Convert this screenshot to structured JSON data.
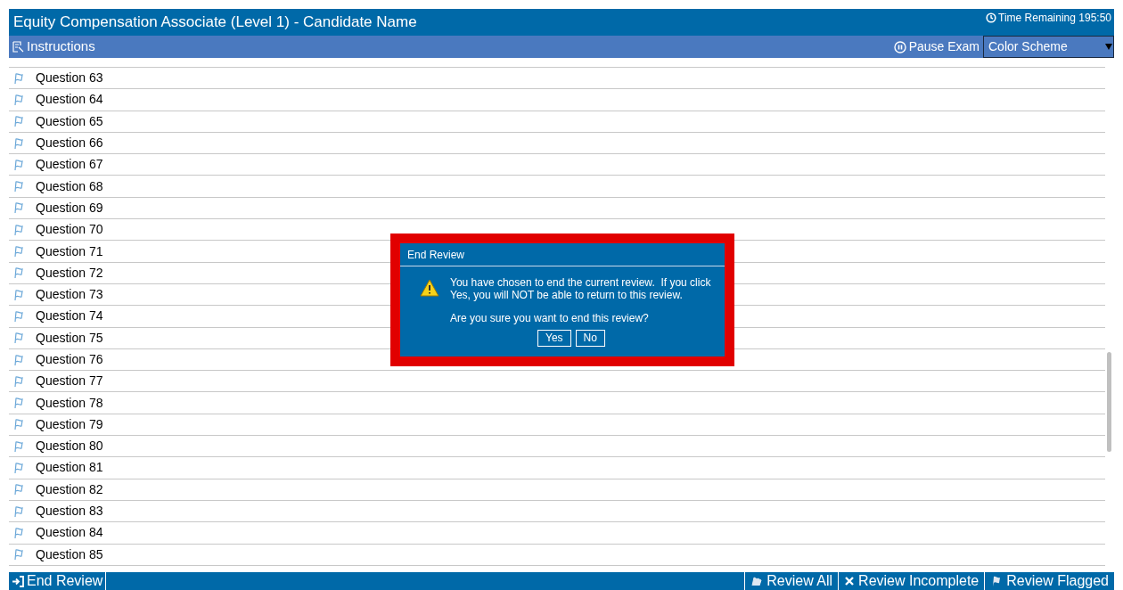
{
  "window": {
    "title": "Equity Compensation Associate (Level 1) - Candidate Name",
    "timer": "Time Remaining 195:50"
  },
  "toolbar": {
    "instructions": "Instructions",
    "pause": "Pause Exam",
    "color_scheme": "Color Scheme"
  },
  "questions": [
    {
      "label": "Question 63"
    },
    {
      "label": "Question 64"
    },
    {
      "label": "Question 65"
    },
    {
      "label": "Question 66"
    },
    {
      "label": "Question 67"
    },
    {
      "label": "Question 68"
    },
    {
      "label": "Question 69"
    },
    {
      "label": "Question 70"
    },
    {
      "label": "Question 71"
    },
    {
      "label": "Question 72"
    },
    {
      "label": "Question 73"
    },
    {
      "label": "Question 74"
    },
    {
      "label": "Question 75"
    },
    {
      "label": "Question 76"
    },
    {
      "label": "Question 77"
    },
    {
      "label": "Question 78"
    },
    {
      "label": "Question 79"
    },
    {
      "label": "Question 80"
    },
    {
      "label": "Question 81"
    },
    {
      "label": "Question 82"
    },
    {
      "label": "Question 83"
    },
    {
      "label": "Question 84"
    },
    {
      "label": "Question 85"
    }
  ],
  "dialog": {
    "title": "End Review",
    "message": "You have chosen to end the current review.  If you click Yes, you will NOT be able to return to this review.",
    "question": "Are you sure you want to end this review?",
    "buttons": [
      "Yes",
      "No"
    ]
  },
  "bottom_bar": {
    "end": "End Review",
    "actions": [
      {
        "kind": "all",
        "label": "Review All"
      },
      {
        "kind": "incomplete",
        "label": "Review Incomplete"
      },
      {
        "kind": "flagged",
        "label": "Review Flagged"
      }
    ]
  }
}
